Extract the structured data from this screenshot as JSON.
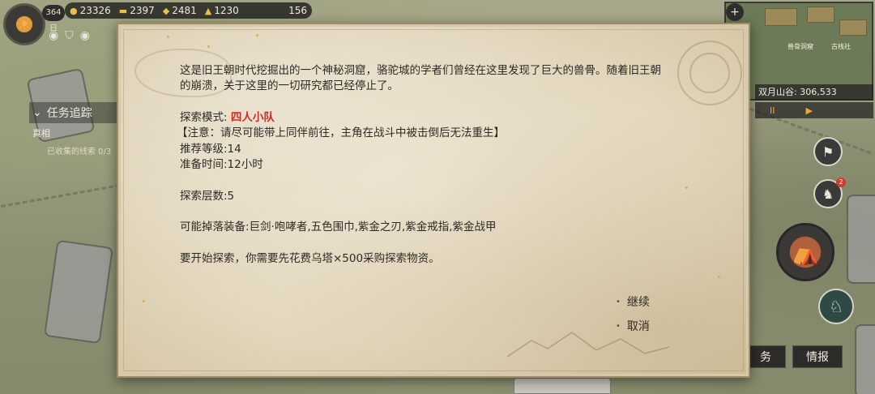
{
  "hud": {
    "day": "364日",
    "resources": [
      {
        "icon": "coin-icon",
        "value": "23326"
      },
      {
        "icon": "gold-bar-icon",
        "value": "2397"
      },
      {
        "icon": "scroll-icon",
        "value": "2481"
      },
      {
        "icon": "bag-icon",
        "value": "1230"
      },
      {
        "icon": "resource-icon",
        "value": "156"
      }
    ]
  },
  "quest": {
    "title": "任务追踪",
    "name": "真相",
    "progress": "已收集的线索 0/3"
  },
  "minimap": {
    "labels": [
      "兽骨洞窟",
      "古栈社"
    ],
    "area": "双月山谷: 306,533",
    "pause_label": "II"
  },
  "sidebar": {
    "notify_count": "2",
    "tab_quest": "务",
    "tab_intel": "情报"
  },
  "dialog": {
    "intro_line1": "这是旧王朝时代挖掘出的一个神秘洞窟，骆驼城的学者们曾经在这里发现了巨大的兽骨。随着旧王朝",
    "intro_line2": "的崩溃，关于这里的一切研究都已经停止了。",
    "mode_label": "探索模式: ",
    "mode_value": "四人小队",
    "note": "【注意：请尽可能带上同伴前往，主角在战斗中被击倒后无法重生】",
    "level": "推荐等级:14",
    "prep_time": "准备时间:12小时",
    "floors": "探索层数:5",
    "drops": "可能掉落装备:巨剑·咆哮者,五色围巾,紫金之刃,紫金戒指,紫金战甲",
    "cost": "要开始探索，你需要先花费乌塔×500采购探索物资。",
    "continue_label": "继续",
    "cancel_label": "取消"
  },
  "colors": {
    "parchment": "#e6dcc4",
    "text": "#2e2a24",
    "highlight_red": "#d22a20",
    "accent_orange": "#f0a43b"
  }
}
